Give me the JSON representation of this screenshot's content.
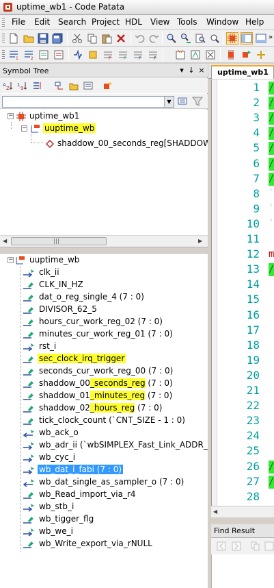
{
  "window": {
    "title": "uptime_wb1 - Code Patata"
  },
  "menu": [
    "File",
    "Edit",
    "Search",
    "Project",
    "HDL",
    "View",
    "Tools",
    "Window",
    "Help"
  ],
  "symbol_tree": {
    "title": "Symbol Tree",
    "pin_label": "↓",
    "close_label": "×",
    "filter_value": "",
    "top_tree": {
      "root": "uptime_wb1",
      "module": "uuptime_wb",
      "instance": "shaddow_00_seconds_reg[SHADDOW_AL"
    },
    "bottom_tree": {
      "root": "uuptime_wb",
      "signals": [
        "clk_ii",
        "CLK_IN_HZ",
        "dat_o_reg_single_4 (7 : 0)",
        "DIVISOR_62_5",
        "hours_cur_work_reg_02 (7 : 0)",
        "minutes_cur_work_reg_01 (7 : 0)",
        "rst_i",
        "sec_clock_irq_trigger",
        "seconds_cur_work_reg_00 (7 : 0)",
        "wb_ack_o",
        "wb_adr_ii (`wbSIMPLEX_Fast_Link_ADDR_BUS",
        "wb_cyc_i",
        "wb_dat_i_fabi (7 : 0)",
        "wb_dat_single_as_sampler_o (7 : 0)",
        "wb_Read_import_via_r4",
        "wb_stb_i",
        "wb_tigger_flg",
        "wb_we_i",
        "wb_Write_export_via_rNULL"
      ],
      "shadow_rows": [
        {
          "prefix": "shaddow_00",
          "mid": "_seconds_reg",
          "suffix": " (7 : 0)"
        },
        {
          "prefix": "shaddow_01",
          "mid": "_minutes_reg",
          "suffix": " (7 : 0)"
        },
        {
          "prefix": "shaddow_02",
          "mid": "_hours_reg",
          "suffix": " (7 : 0)"
        }
      ],
      "tick_row": "tick_clock_count (`CNT_SIZE - 1 : 0)"
    }
  },
  "editor": {
    "tab_label": "uptime_wb1",
    "line_numbers": [
      "1",
      "2",
      "3",
      "4",
      "5",
      "6",
      "7",
      "8",
      "9",
      "10",
      "11",
      "12",
      "13",
      "14",
      "15",
      "16",
      "17",
      "18",
      "19",
      "20",
      "21",
      "22",
      "23",
      "24",
      "25",
      "26",
      "27",
      "28"
    ],
    "code_glyphs": [
      "/",
      "/",
      "/",
      "/",
      "/",
      "/",
      "/",
      "`",
      "`",
      "`",
      "",
      "m",
      "/",
      "",
      "",
      "",
      "",
      "",
      "",
      "",
      "",
      "",
      "",
      "",
      "",
      "/",
      "/",
      ""
    ]
  },
  "find_result": {
    "title": "Find Result"
  },
  "colors": {
    "highlight": "#ffff2e",
    "selection": "#3399ff",
    "code_green": "#37e837",
    "line_number": "#00a0a0"
  }
}
